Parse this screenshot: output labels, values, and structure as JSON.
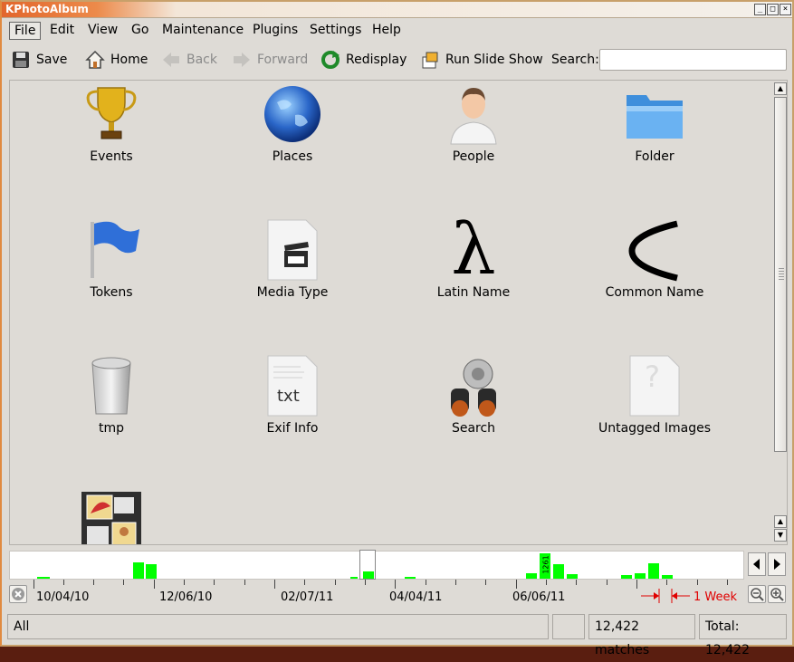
{
  "window": {
    "title": "KPhotoAlbum"
  },
  "menubar": {
    "items": [
      {
        "label": "File"
      },
      {
        "label": "Edit"
      },
      {
        "label": "View"
      },
      {
        "label": "Go"
      },
      {
        "label": "Maintenance"
      },
      {
        "label": "Plugins"
      },
      {
        "label": "Settings"
      },
      {
        "label": "Help"
      }
    ]
  },
  "toolbar": {
    "save_label": "Save",
    "home_label": "Home",
    "back_label": "Back",
    "forward_label": "Forward",
    "redisplay_label": "Redisplay",
    "slideshow_label": "Run Slide Show",
    "search_label": "Search:",
    "search_value": ""
  },
  "browser": {
    "categories": [
      {
        "label": "Events",
        "icon": "trophy-icon"
      },
      {
        "label": "Places",
        "icon": "globe-icon"
      },
      {
        "label": "People",
        "icon": "person-icon"
      },
      {
        "label": "Folder",
        "icon": "folder-icon"
      },
      {
        "label": "Tokens",
        "icon": "flag-icon"
      },
      {
        "label": "Media Type",
        "icon": "clapperboard-icon"
      },
      {
        "label": "Latin Name",
        "icon": "lambda-icon",
        "glyph": "λ"
      },
      {
        "label": "Common Name",
        "icon": "less-than-icon",
        "glyph": "<"
      },
      {
        "label": "tmp",
        "icon": "trash-icon"
      },
      {
        "label": "Exif Info",
        "icon": "text-file-icon",
        "glyph": "txt"
      },
      {
        "label": "Search",
        "icon": "binoculars-icon"
      },
      {
        "label": "Untagged Images",
        "icon": "unknown-file-icon",
        "glyph": "?"
      },
      {
        "label": "",
        "icon": "photo-album-icon"
      }
    ]
  },
  "timeline": {
    "labels": [
      "10/04/10",
      "12/06/10",
      "02/07/11",
      "04/04/11",
      "06/06/11"
    ],
    "bar_peak_label": "1261",
    "unit_label": "1 Week"
  },
  "statusbar": {
    "filter": "All",
    "matches": "12,422 matches",
    "total": "Total: 12,422"
  },
  "colors": {
    "background": "#dedbd6",
    "timeline_bar": "#00ff00",
    "unit_marker": "#e00000",
    "title_accent": "#e2662c"
  }
}
